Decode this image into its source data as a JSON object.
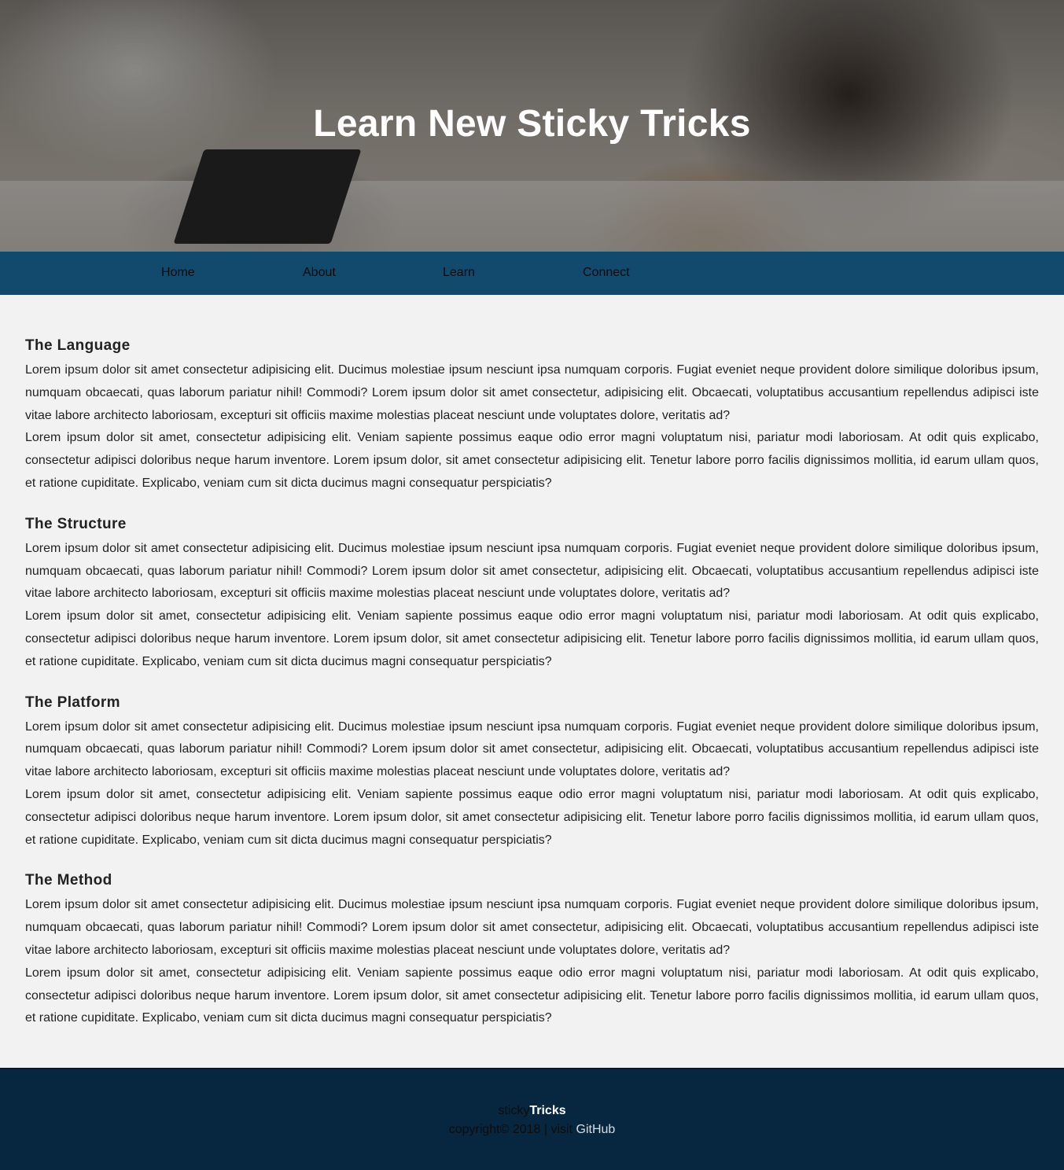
{
  "hero": {
    "title": "Learn New Sticky Tricks"
  },
  "nav": {
    "items": [
      {
        "label": "Home"
      },
      {
        "label": "About"
      },
      {
        "label": "Learn"
      },
      {
        "label": "Connect"
      }
    ]
  },
  "sections": [
    {
      "heading": "The Language",
      "p1": "Lorem ipsum dolor sit amet consectetur adipisicing elit. Ducimus molestiae ipsum nesciunt ipsa numquam corporis. Fugiat eveniet neque provident dolore similique doloribus ipsum, numquam obcaecati, quas laborum pariatur nihil! Commodi? Lorem ipsum dolor sit amet consectetur, adipisicing elit. Obcaecati, voluptatibus accusantium repellendus adipisci iste vitae labore architecto laboriosam, excepturi sit officiis maxime molestias placeat nesciunt unde voluptates dolore, veritatis ad?",
      "p2": "Lorem ipsum dolor sit amet, consectetur adipisicing elit. Veniam sapiente possimus eaque odio error magni voluptatum nisi, pariatur modi laboriosam. At odit quis explicabo, consectetur adipisci doloribus neque harum inventore. Lorem ipsum dolor, sit amet consectetur adipisicing elit. Tenetur labore porro facilis dignissimos mollitia, id earum ullam quos, et ratione cupiditate. Explicabo, veniam cum sit dicta ducimus magni consequatur perspiciatis?"
    },
    {
      "heading": "The Structure",
      "p1": "Lorem ipsum dolor sit amet consectetur adipisicing elit. Ducimus molestiae ipsum nesciunt ipsa numquam corporis. Fugiat eveniet neque provident dolore similique doloribus ipsum, numquam obcaecati, quas laborum pariatur nihil! Commodi? Lorem ipsum dolor sit amet consectetur, adipisicing elit. Obcaecati, voluptatibus accusantium repellendus adipisci iste vitae labore architecto laboriosam, excepturi sit officiis maxime molestias placeat nesciunt unde voluptates dolore, veritatis ad?",
      "p2": "Lorem ipsum dolor sit amet, consectetur adipisicing elit. Veniam sapiente possimus eaque odio error magni voluptatum nisi, pariatur modi laboriosam. At odit quis explicabo, consectetur adipisci doloribus neque harum inventore. Lorem ipsum dolor, sit amet consectetur adipisicing elit. Tenetur labore porro facilis dignissimos mollitia, id earum ullam quos, et ratione cupiditate. Explicabo, veniam cum sit dicta ducimus magni consequatur perspiciatis?"
    },
    {
      "heading": "The Platform",
      "p1": "Lorem ipsum dolor sit amet consectetur adipisicing elit. Ducimus molestiae ipsum nesciunt ipsa numquam corporis. Fugiat eveniet neque provident dolore similique doloribus ipsum, numquam obcaecati, quas laborum pariatur nihil! Commodi? Lorem ipsum dolor sit amet consectetur, adipisicing elit. Obcaecati, voluptatibus accusantium repellendus adipisci iste vitae labore architecto laboriosam, excepturi sit officiis maxime molestias placeat nesciunt unde voluptates dolore, veritatis ad?",
      "p2": "Lorem ipsum dolor sit amet, consectetur adipisicing elit. Veniam sapiente possimus eaque odio error magni voluptatum nisi, pariatur modi laboriosam. At odit quis explicabo, consectetur adipisci doloribus neque harum inventore. Lorem ipsum dolor, sit amet consectetur adipisicing elit. Tenetur labore porro facilis dignissimos mollitia, id earum ullam quos, et ratione cupiditate. Explicabo, veniam cum sit dicta ducimus magni consequatur perspiciatis?"
    },
    {
      "heading": "The Method",
      "p1": "Lorem ipsum dolor sit amet consectetur adipisicing elit. Ducimus molestiae ipsum nesciunt ipsa numquam corporis. Fugiat eveniet neque provident dolore similique doloribus ipsum, numquam obcaecati, quas laborum pariatur nihil! Commodi? Lorem ipsum dolor sit amet consectetur, adipisicing elit. Obcaecati, voluptatibus accusantium repellendus adipisci iste vitae labore architecto laboriosam, excepturi sit officiis maxime molestias placeat nesciunt unde voluptates dolore, veritatis ad?",
      "p2": "Lorem ipsum dolor sit amet, consectetur adipisicing elit. Veniam sapiente possimus eaque odio error magni voluptatum nisi, pariatur modi laboriosam. At odit quis explicabo, consectetur adipisci doloribus neque harum inventore. Lorem ipsum dolor, sit amet consectetur adipisicing elit. Tenetur labore porro facilis dignissimos mollitia, id earum ullam quos, et ratione cupiditate. Explicabo, veniam cum sit dicta ducimus magni consequatur perspiciatis?"
    }
  ],
  "footer": {
    "brand_prefix": "sticky",
    "brand_suffix": "Tricks",
    "copyright": "copyright© 2018 | visit ",
    "link_label": "GitHub"
  },
  "colors": {
    "nav_bg": "#124a6e",
    "footer_bg": "#072740",
    "page_bg": "#f2f2f2"
  }
}
